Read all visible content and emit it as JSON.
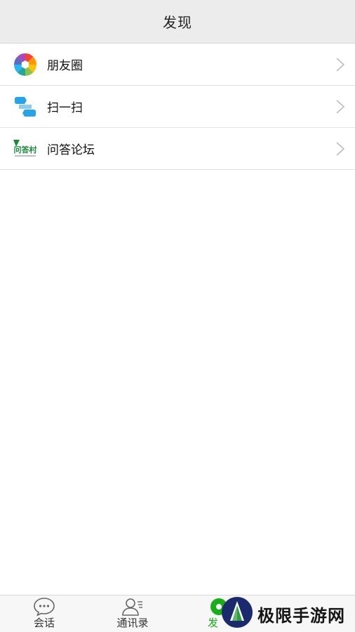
{
  "header": {
    "title": "发现"
  },
  "list": {
    "items": [
      {
        "label": "朋友圈",
        "icon": "moments-aperture-icon"
      },
      {
        "label": "扫一扫",
        "icon": "scan-icon"
      },
      {
        "label": "问答论坛",
        "icon": "wendacun-logo-icon",
        "icon_text": "问答村"
      }
    ],
    "chevron_icon": "chevron-right-icon"
  },
  "tabbar": {
    "tabs": [
      {
        "label": "会话",
        "icon": "chat-bubble-icon"
      },
      {
        "label": "通讯录",
        "icon": "contacts-icon"
      },
      {
        "label": "发",
        "icon": "discover-icon",
        "active": true
      }
    ],
    "active_color": "#1aad19"
  },
  "watermark": {
    "text": "极限手游网"
  },
  "colors": {
    "header_bg": "#ececec",
    "accent": "#1aad19",
    "divider": "#e3e3e3"
  }
}
